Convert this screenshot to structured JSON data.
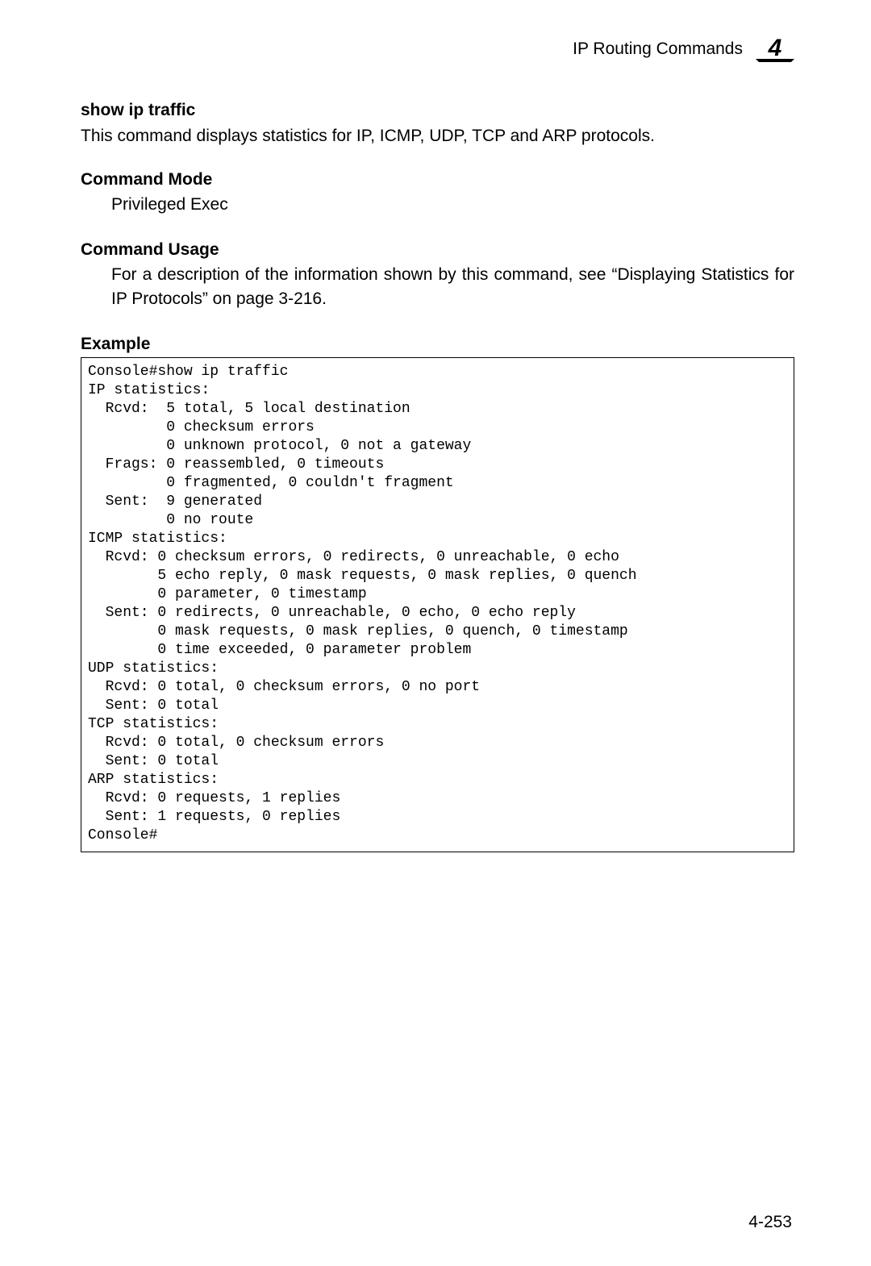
{
  "header": {
    "category": "IP Routing Commands",
    "chapter": "4"
  },
  "command": {
    "name": "show ip traffic",
    "description": "This command displays statistics for IP, ICMP, UDP, TCP and ARP protocols."
  },
  "command_mode": {
    "heading": "Command Mode",
    "value": "Privileged Exec"
  },
  "command_usage": {
    "heading": "Command Usage",
    "value": "For a description of the information shown by this command, see “Displaying Statistics for IP Protocols” on page 3-216."
  },
  "example": {
    "heading": "Example",
    "console_output": "Console#show ip traffic\nIP statistics:\n  Rcvd:  5 total, 5 local destination\n         0 checksum errors\n         0 unknown protocol, 0 not a gateway\n  Frags: 0 reassembled, 0 timeouts\n         0 fragmented, 0 couldn't fragment\n  Sent:  9 generated\n         0 no route\nICMP statistics:\n  Rcvd: 0 checksum errors, 0 redirects, 0 unreachable, 0 echo\n        5 echo reply, 0 mask requests, 0 mask replies, 0 quench\n        0 parameter, 0 timestamp\n  Sent: 0 redirects, 0 unreachable, 0 echo, 0 echo reply\n        0 mask requests, 0 mask replies, 0 quench, 0 timestamp\n        0 time exceeded, 0 parameter problem\nUDP statistics:\n  Rcvd: 0 total, 0 checksum errors, 0 no port\n  Sent: 0 total\nTCP statistics:\n  Rcvd: 0 total, 0 checksum errors\n  Sent: 0 total\nARP statistics:\n  Rcvd: 0 requests, 1 replies\n  Sent: 1 requests, 0 replies\nConsole#"
  },
  "page_number": "4-253"
}
